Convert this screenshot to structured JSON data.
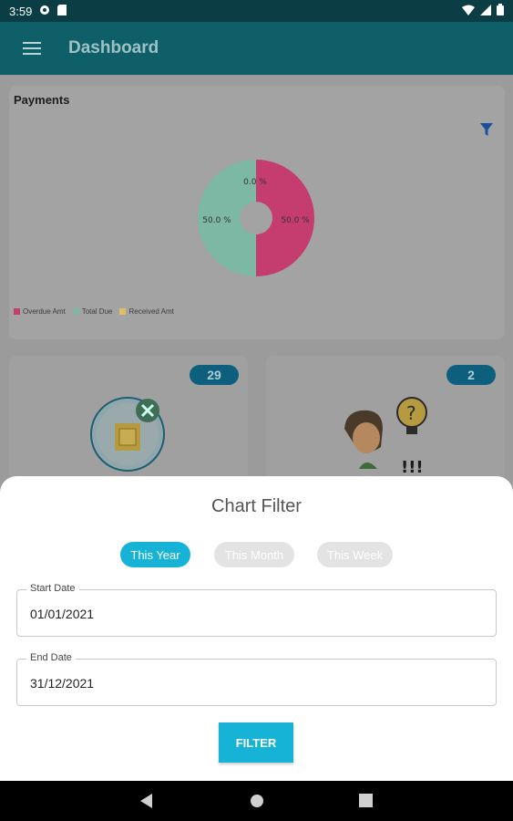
{
  "status_bar": {
    "time": "3:59"
  },
  "app_bar": {
    "title": "Dashboard"
  },
  "payments": {
    "title": "Payments",
    "chart_data": {
      "type": "pie",
      "categories": [
        "Overdue Amt",
        "Total Due",
        "Received Amt"
      ],
      "values": [
        50.0,
        50.0,
        0.0
      ],
      "labels": [
        "50.0 %",
        "50.0 %",
        "0.0 %"
      ],
      "colors": [
        "#d0195e",
        "#6fbfa3",
        "#f2c94c"
      ]
    }
  },
  "cards": [
    {
      "count": "29"
    },
    {
      "count": "2"
    }
  ],
  "sheet": {
    "title": "Chart Filter",
    "chips": [
      "This Year",
      "This Month",
      "This Week"
    ],
    "start_date": {
      "label": "Start Date",
      "value": "01/01/2021"
    },
    "end_date": {
      "label": "End Date",
      "value": "31/12/2021"
    },
    "filter_label": "FILTER"
  },
  "colors": {
    "accent": "#17b3d6",
    "app_bar": "#0f5f69"
  }
}
